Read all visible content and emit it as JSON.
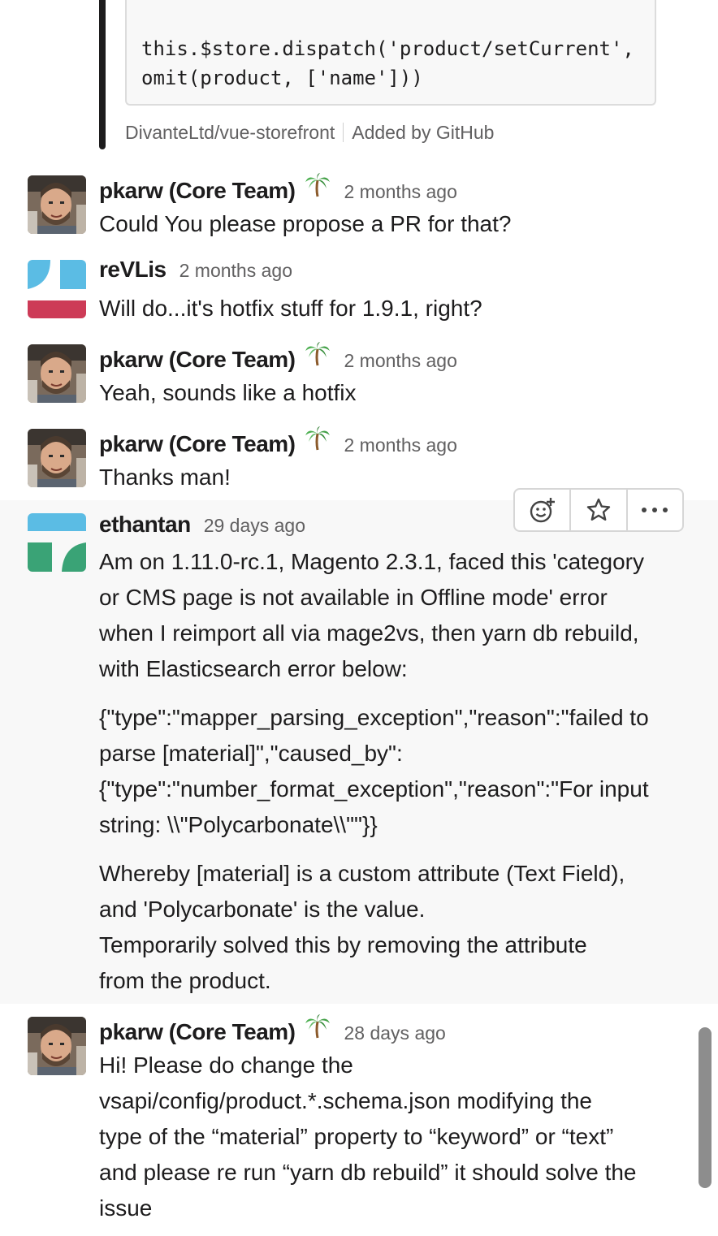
{
  "attachment": {
    "code_lines": [
      "this.$store.dispatch('product/setCurrent',",
      "omit(product, ['name']))"
    ],
    "repo": "DivanteLtd/vue-storefront",
    "added_by": "Added by GitHub"
  },
  "messages": [
    {
      "author": "pkarw (Core Team)",
      "status_emoji": "palm-tree-icon",
      "time": "2 months ago",
      "lines": [
        "Could You please propose a PR for that?"
      ]
    },
    {
      "author": "reVLis",
      "time": "2 months ago",
      "lines": [
        "Will do...it's hotfix stuff for 1.9.1, right?"
      ]
    },
    {
      "author": "pkarw (Core Team)",
      "status_emoji": "palm-tree-icon",
      "time": "2 months ago",
      "lines": [
        "Yeah, sounds like a hotfix"
      ]
    },
    {
      "author": "pkarw (Core Team)",
      "status_emoji": "palm-tree-icon",
      "time": "2 months ago",
      "lines": [
        "Thanks man!"
      ]
    },
    {
      "author": "ethantan",
      "time": "29 days ago",
      "paragraphs": [
        [
          "Am on 1.11.0-rc.1, Magento 2.3.1, faced this 'category",
          "or CMS page is not available in Offline mode' error",
          "when I reimport all via mage2vs, then yarn db rebuild,",
          "with Elasticsearch error below:"
        ],
        [
          "{\"type\":\"mapper_parsing_exception\",\"reason\":\"failed to",
          "parse [material]\",\"caused_by\":",
          "{\"type\":\"number_format_exception\",\"reason\":\"For input",
          "string: \\\\\"Polycarbonate\\\\\"\"}}"
        ],
        [
          "Whereby [material] is a custom attribute (Text Field),",
          "and 'Polycarbonate' is the value.",
          "Temporarily solved this by removing the attribute",
          "from the product."
        ]
      ]
    },
    {
      "author": "pkarw (Core Team)",
      "status_emoji": "palm-tree-icon",
      "time": "28 days ago",
      "lines": [
        "Hi! Please do change the",
        "vsapi/config/product.*.schema.json modifying the",
        "type of the “material” property to “keyword” or “text”",
        "and please re run “yarn db rebuild” it should solve the",
        "issue"
      ]
    }
  ],
  "toolbar": {
    "icons": [
      "add-reaction-icon",
      "star-icon",
      "more-actions-icon"
    ]
  },
  "colors": {
    "revlis_blue": "#5bbce4",
    "revlis_red": "#cd3b57",
    "ethantan_blue": "#5bbce4",
    "ethantan_green": "#3aa376",
    "timestamp": "#616061",
    "highlight_bg": "#f8f8f8"
  }
}
